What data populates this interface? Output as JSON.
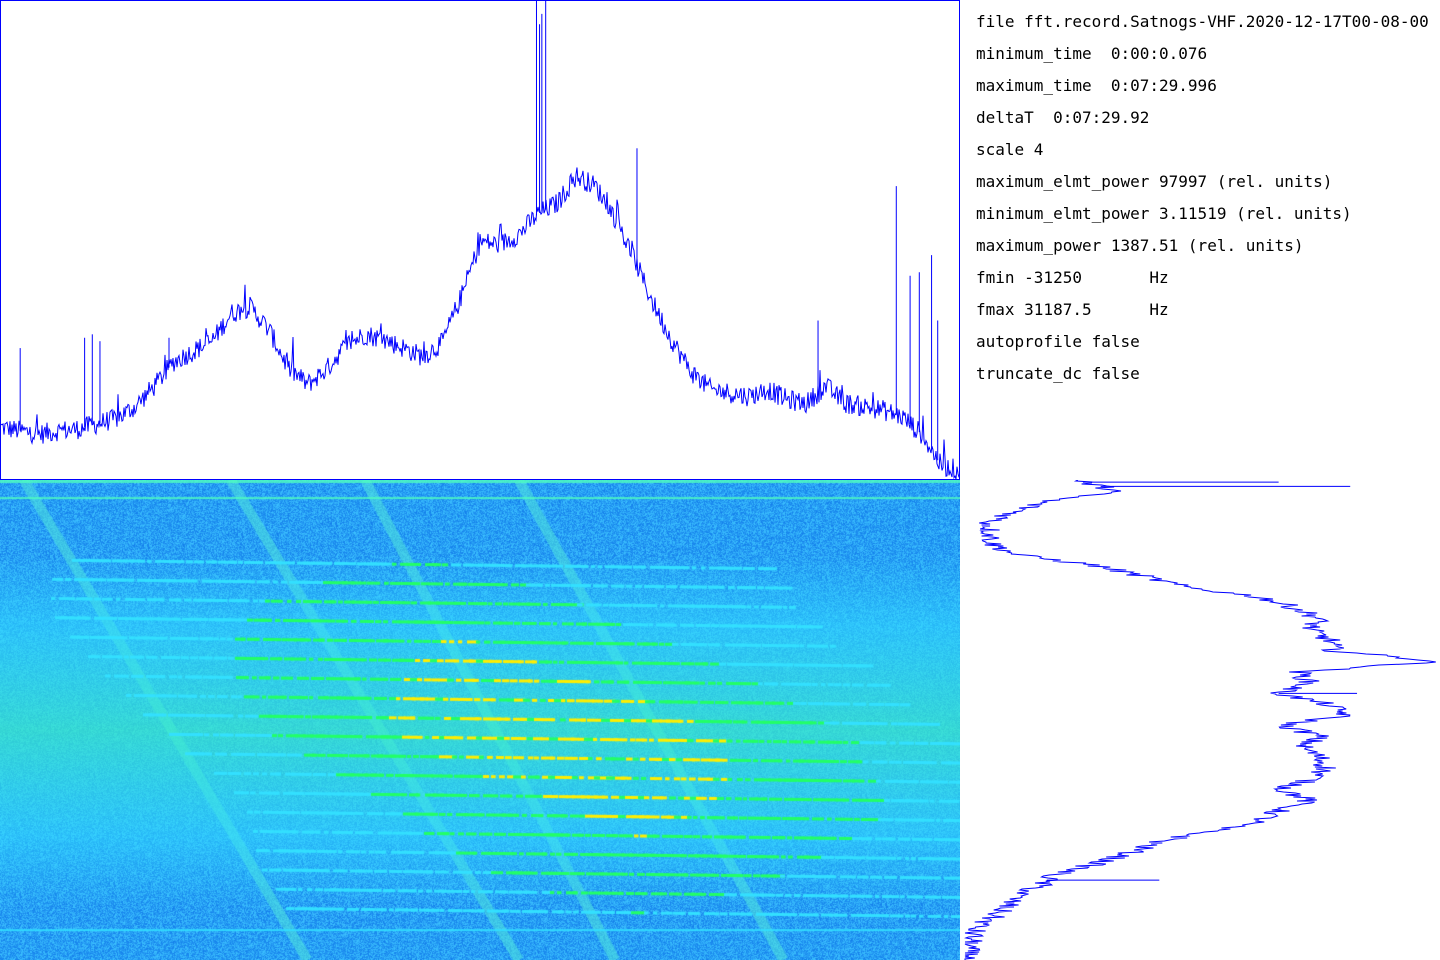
{
  "info": {
    "lines": [
      "file fft.record.Satnogs-VHF.2020-12-17T00-08-00",
      "minimum_time  0:00:0.076",
      "maximum_time  0:07:29.996",
      "deltaT  0:07:29.92",
      "scale 4",
      "maximum_elmt_power 97997 (rel. units)",
      "minimum_elmt_power 3.11519 (rel. units)",
      "maximum_power 1387.51 (rel. units)",
      "fmin -31250       Hz",
      "fmax 31187.5      Hz",
      "autoprofile false",
      "truncate_dc false"
    ]
  },
  "colors": {
    "trace": "#0000ff",
    "waterfall_background": "#3aa6ff",
    "waterfall_mid": "#33e0ff",
    "waterfall_high": "#22ff66",
    "waterfall_peak": "#ffee00"
  },
  "chart_data": [
    {
      "type": "line",
      "xlim": [
        -31250,
        31187.5
      ],
      "ylim": [
        0,
        1387.51
      ],
      "x": [
        -31250,
        -30000,
        -28750,
        -27500,
        -26250,
        -25000,
        -23750,
        -22500,
        -21250,
        -20000,
        -18750,
        -17500,
        -16250,
        -15000,
        -13750,
        -12500,
        -11250,
        -10000,
        -8750,
        -7500,
        -6250,
        -5000,
        -3750,
        -2500,
        -1250,
        0,
        1250,
        2500,
        3750,
        5000,
        6250,
        7500,
        8750,
        10000,
        11250,
        12500,
        13750,
        15000,
        16250,
        17500,
        18750,
        20000,
        21250,
        22500,
        23750,
        25000,
        26250,
        27500,
        28750,
        30000,
        31187.5
      ],
      "y": [
        150,
        140,
        130,
        140,
        145,
        160,
        175,
        210,
        270,
        340,
        370,
        400,
        480,
        500,
        430,
        320,
        275,
        320,
        390,
        420,
        405,
        380,
        355,
        395,
        530,
        690,
        680,
        710,
        770,
        800,
        880,
        850,
        760,
        640,
        510,
        400,
        310,
        260,
        250,
        240,
        260,
        230,
        220,
        270,
        220,
        210,
        200,
        180,
        130,
        40,
        25
      ],
      "spikes": [
        {
          "x": -30000,
          "y": 380
        },
        {
          "x": -25800,
          "y": 410
        },
        {
          "x": -25300,
          "y": 420
        },
        {
          "x": -24800,
          "y": 400
        },
        {
          "x": -20300,
          "y": 410
        },
        {
          "x": 3650,
          "y": 1387.51
        },
        {
          "x": 3850,
          "y": 1320
        },
        {
          "x": 4000,
          "y": 1350
        },
        {
          "x": 4250,
          "y": 1387.51
        },
        {
          "x": 10200,
          "y": 960
        },
        {
          "x": 22000,
          "y": 460
        },
        {
          "x": 27100,
          "y": 850
        },
        {
          "x": 28000,
          "y": 590
        },
        {
          "x": 28600,
          "y": 600
        },
        {
          "x": 29400,
          "y": 650
        },
        {
          "x": 29800,
          "y": 460
        }
      ]
    },
    {
      "type": "line",
      "orientation": "vertical",
      "ylim": [
        0,
        449.92
      ],
      "y_unit": "s",
      "xlim": [
        0,
        1387.51
      ],
      "y": [
        0,
        10,
        20,
        40,
        60,
        70,
        80,
        90,
        100,
        110,
        120,
        130,
        140,
        150,
        160,
        170,
        180,
        190,
        200,
        210,
        220,
        230,
        240,
        250,
        260,
        270,
        280,
        290,
        300,
        310,
        320,
        330,
        340,
        350,
        360,
        370,
        380,
        390,
        400,
        410,
        420,
        430,
        440,
        449.92
      ],
      "x": [
        320,
        450,
        230,
        70,
        80,
        150,
        380,
        520,
        640,
        870,
        970,
        1040,
        1010,
        1070,
        1080,
        1387.51,
        980,
        1010,
        920,
        1060,
        1120,
        930,
        1040,
        990,
        1040,
        1060,
        1020,
        930,
        1010,
        920,
        860,
        700,
        560,
        480,
        380,
        260,
        220,
        150,
        120,
        80,
        30,
        20,
        10,
        0
      ],
      "spikes": [
        {
          "y": 2,
          "x": 920
        },
        {
          "y": 6,
          "x": 1130
        },
        {
          "y": 170,
          "x": 1387.51
        },
        {
          "y": 200,
          "x": 1150
        },
        {
          "y": 375,
          "x": 570
        }
      ]
    },
    {
      "type": "heatmap",
      "xlim": [
        -31250,
        31187.5
      ],
      "ylim": [
        0,
        449.92
      ],
      "y_unit": "s",
      "band_time_range": [
        70,
        400
      ],
      "band_center_freq_start": -4000,
      "band_center_freq_end": 10000,
      "band_center_time_start": 120,
      "band_center_time_end": 300,
      "line_spacing_s": 18,
      "drift_lines": [
        {
          "x_start": -29700,
          "x_end": -11250
        },
        {
          "x_start": -16250,
          "x_end": 2500
        },
        {
          "x_start": -7500,
          "x_end": 8750
        },
        {
          "x_start": 2500,
          "x_end": 19700
        }
      ]
    }
  ]
}
